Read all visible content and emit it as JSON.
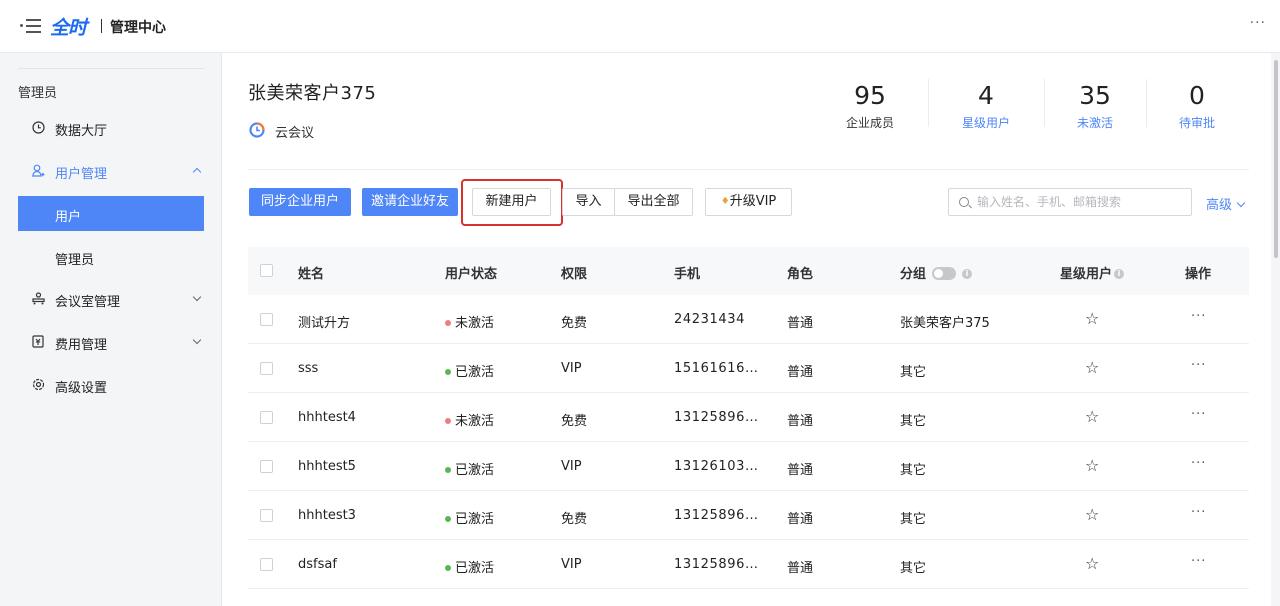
{
  "topbar": {
    "logo": "全时",
    "title": "管理中心",
    "more": "···"
  },
  "sidebar": {
    "section_title": "管理员",
    "items": [
      {
        "label": "数据大厅",
        "icon": "clock-icon"
      },
      {
        "label": "用户管理",
        "icon": "users-icon",
        "expanded": true,
        "children": [
          {
            "label": "用户",
            "active": true
          },
          {
            "label": "管理员"
          }
        ]
      },
      {
        "label": "会议室管理",
        "icon": "meeting-room-icon"
      },
      {
        "label": "费用管理",
        "icon": "billing-icon"
      },
      {
        "label": "高级设置",
        "icon": "settings-icon"
      }
    ]
  },
  "header": {
    "company": "张美荣客户375",
    "product": "云会议",
    "stats": [
      {
        "value": "95",
        "label": "企业成员"
      },
      {
        "value": "4",
        "label": "星级用户"
      },
      {
        "value": "35",
        "label": "未激活"
      },
      {
        "value": "0",
        "label": "待审批"
      }
    ]
  },
  "toolbar": {
    "sync": "同步企业用户",
    "invite": "邀请企业好友",
    "new_user": "新建用户",
    "import": "导入",
    "export_all": "导出全部",
    "upgrade_vip": "升级VIP",
    "search_placeholder": "输入姓名、手机、邮箱搜索",
    "advanced": "高级"
  },
  "colors": {
    "accent": "#4f86f7",
    "inactive": "#f07c82",
    "active": "#5ab552",
    "highlight": "#d9322e"
  },
  "table": {
    "columns": [
      "姓名",
      "用户状态",
      "权限",
      "手机",
      "角色",
      "分组",
      "星级用户",
      "操作"
    ],
    "rows": [
      {
        "name": "测试升方",
        "status": "未激活",
        "status_type": "inactive",
        "permission": "免费",
        "phone": "24231434",
        "role": "普通",
        "group": "张美荣客户375"
      },
      {
        "name": "sss",
        "status": "已激活",
        "status_type": "active",
        "permission": "VIP",
        "phone": "15161616…",
        "role": "普通",
        "group": "其它"
      },
      {
        "name": "hhhtest4",
        "status": "未激活",
        "status_type": "inactive",
        "permission": "免费",
        "phone": "13125896…",
        "role": "普通",
        "group": "其它"
      },
      {
        "name": "hhhtest5",
        "status": "已激活",
        "status_type": "active",
        "permission": "VIP",
        "phone": "13126103…",
        "role": "普通",
        "group": "其它"
      },
      {
        "name": "hhhtest3",
        "status": "已激活",
        "status_type": "active",
        "permission": "免费",
        "phone": "13125896…",
        "role": "普通",
        "group": "其它"
      },
      {
        "name": "dsfsaf",
        "status": "已激活",
        "status_type": "active",
        "permission": "VIP",
        "phone": "13125896…",
        "role": "普通",
        "group": "其它"
      }
    ]
  }
}
